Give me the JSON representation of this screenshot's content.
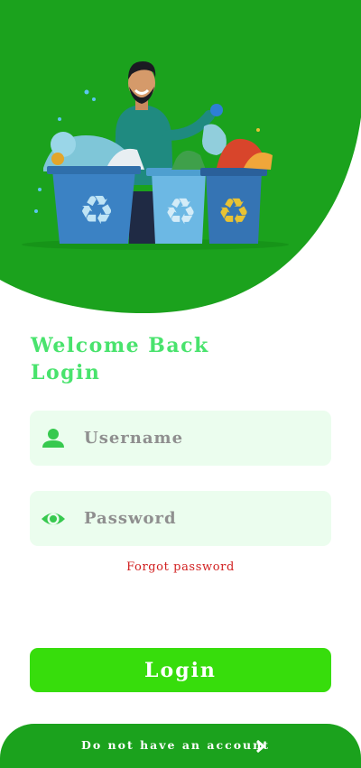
{
  "header": {
    "welcome_line1": "Welcome Back",
    "welcome_line2": "Login"
  },
  "form": {
    "username_placeholder": "Username",
    "password_placeholder": "Password",
    "forgot_label": "Forgot password",
    "login_label": "Login"
  },
  "footer": {
    "signup_label": "Do not have an account"
  },
  "colors": {
    "hero_green": "#1ba21d",
    "accent_green": "#49e36d",
    "button_green": "#37dd0c",
    "field_bg": "#ebfdee",
    "forgot_red": "#d11f1f"
  },
  "icons": {
    "username": "person-icon",
    "password": "eye-icon",
    "signup": "chevron-right-icon"
  }
}
